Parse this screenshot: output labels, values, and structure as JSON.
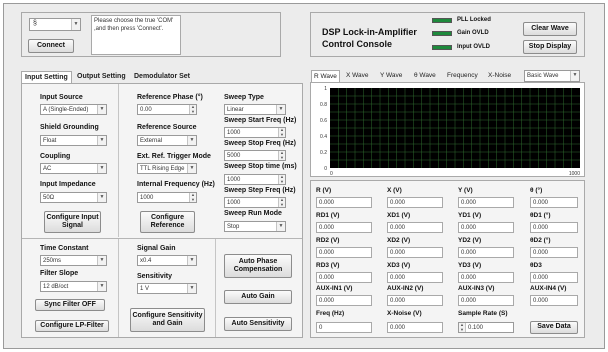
{
  "connection": {
    "com_value": "",
    "message": "Please choose the true 'COM' ,and then press 'Connect'.",
    "connect_label": "Connect"
  },
  "header": {
    "title_line1": "DSP Lock-in-Amplifier",
    "title_line2": "Control Console",
    "status": [
      {
        "label": "PLL Locked",
        "color": "#1e8a3c"
      },
      {
        "label": "Gain OVLD",
        "color": "#1e8a3c"
      },
      {
        "label": "Input OVLD",
        "color": "#1e8a3c"
      }
    ],
    "clear_wave_label": "Clear Wave",
    "stop_display_label": "Stop Display"
  },
  "left_tabs": [
    "Input Setting",
    "Output Setting",
    "Demodulator Set"
  ],
  "input": {
    "input_source_label": "Input Source",
    "input_source_value": "A (Single-Ended)",
    "shield_grounding_label": "Shield Grounding",
    "shield_grounding_value": "Float",
    "coupling_label": "Coupling",
    "coupling_value": "AC",
    "input_impedance_label": "Input Impedance",
    "input_impedance_value": "50Ω",
    "configure_input_label": "Configure Input Signal"
  },
  "reference": {
    "phase_label": "Reference Phase (°)",
    "phase_value": "0.00",
    "source_label": "Reference Source",
    "source_value": "External",
    "trigger_label": "Ext. Ref. Trigger Mode",
    "trigger_value": "TTL Rising Edge",
    "freq_label": "Internal Frequency (Hz)",
    "freq_value": "1000",
    "configure_label": "Configure Reference"
  },
  "sweep": {
    "type_label": "Sweep Type",
    "type_value": "Linear",
    "start_label": "Sweep Start Freq (Hz)",
    "start_value": "1000",
    "stop_label": "Sweep Stop Freq (Hz)",
    "stop_value": "5000",
    "stop_time_label": "Sweep Stop time (ms)",
    "stop_time_value": "1000",
    "step_label": "Sweep Step Freq (Hz)",
    "step_value": "1000",
    "run_mode_label": "Sweep Run Mode",
    "run_mode_value": "Stop"
  },
  "filter": {
    "time_constant_label": "Time Constant",
    "time_constant_value": "250ms",
    "slope_label": "Filter Slope",
    "slope_value": "12 dB/oct",
    "sync_label": "Sync Filter OFF",
    "configure_lp_label": "Configure LP-Filter"
  },
  "gain": {
    "signal_gain_label": "Signal Gain",
    "signal_gain_value": "x0.4",
    "sensitivity_label": "Sensitivity",
    "sensitivity_value": "1 V",
    "configure_label": "Configure Sensitivity and Gain",
    "auto_phase_label": "Auto Phase Compensation",
    "auto_gain_label": "Auto Gain",
    "auto_sens_label": "Auto Sensitivity"
  },
  "right_tabs": [
    "R Wave",
    "X Wave",
    "Y Wave",
    "θ Wave",
    "Frequency",
    "X-Noise"
  ],
  "wave_select": "Basic Wave",
  "chart_data": {
    "type": "line",
    "x_ticks": [
      "0",
      "1000"
    ],
    "y_ticks": [
      "1",
      "0.8",
      "0.6",
      "0.4",
      "0.2",
      "0"
    ],
    "xlim": [
      0,
      1000
    ],
    "ylim": [
      0,
      1
    ],
    "series": [],
    "grid": true,
    "background": "#000000",
    "grid_color": "#2e6a2e"
  },
  "readouts": [
    {
      "label": "R (V)",
      "value": "0.000"
    },
    {
      "label": "X (V)",
      "value": "0.000"
    },
    {
      "label": "Y (V)",
      "value": "0.000"
    },
    {
      "label": "θ (°)",
      "value": "0.000"
    },
    {
      "label": "RD1 (V)",
      "value": "0.000"
    },
    {
      "label": "XD1 (V)",
      "value": "0.000"
    },
    {
      "label": "YD1 (V)",
      "value": "0.000"
    },
    {
      "label": "θD1 (°)",
      "value": "0.000"
    },
    {
      "label": "RD2 (V)",
      "value": "0.000"
    },
    {
      "label": "XD2 (V)",
      "value": "0.000"
    },
    {
      "label": "YD2 (V)",
      "value": "0.000"
    },
    {
      "label": "θD2 (°)",
      "value": "0.000"
    },
    {
      "label": "RD3 (V)",
      "value": "0.000"
    },
    {
      "label": "XD3 (V)",
      "value": "0.000"
    },
    {
      "label": "YD3 (V)",
      "value": "0.000"
    },
    {
      "label": "θD3",
      "value": "0.000"
    },
    {
      "label": "AUX-IN1 (V)",
      "value": "0.000"
    },
    {
      "label": "AUX-IN2 (V)",
      "value": "0.000"
    },
    {
      "label": "AUX-IN3 (V)",
      "value": "0.000"
    },
    {
      "label": "AUX-IN4 (V)",
      "value": "0.000"
    }
  ],
  "bottom": {
    "freq_label": "Freq (Hz)",
    "freq_value": "0",
    "xnoise_label": "X-Noise (V)",
    "xnoise_value": "0.000",
    "rate_label": "Sample Rate (S)",
    "rate_value": "0.100",
    "save_label": "Save Data"
  }
}
